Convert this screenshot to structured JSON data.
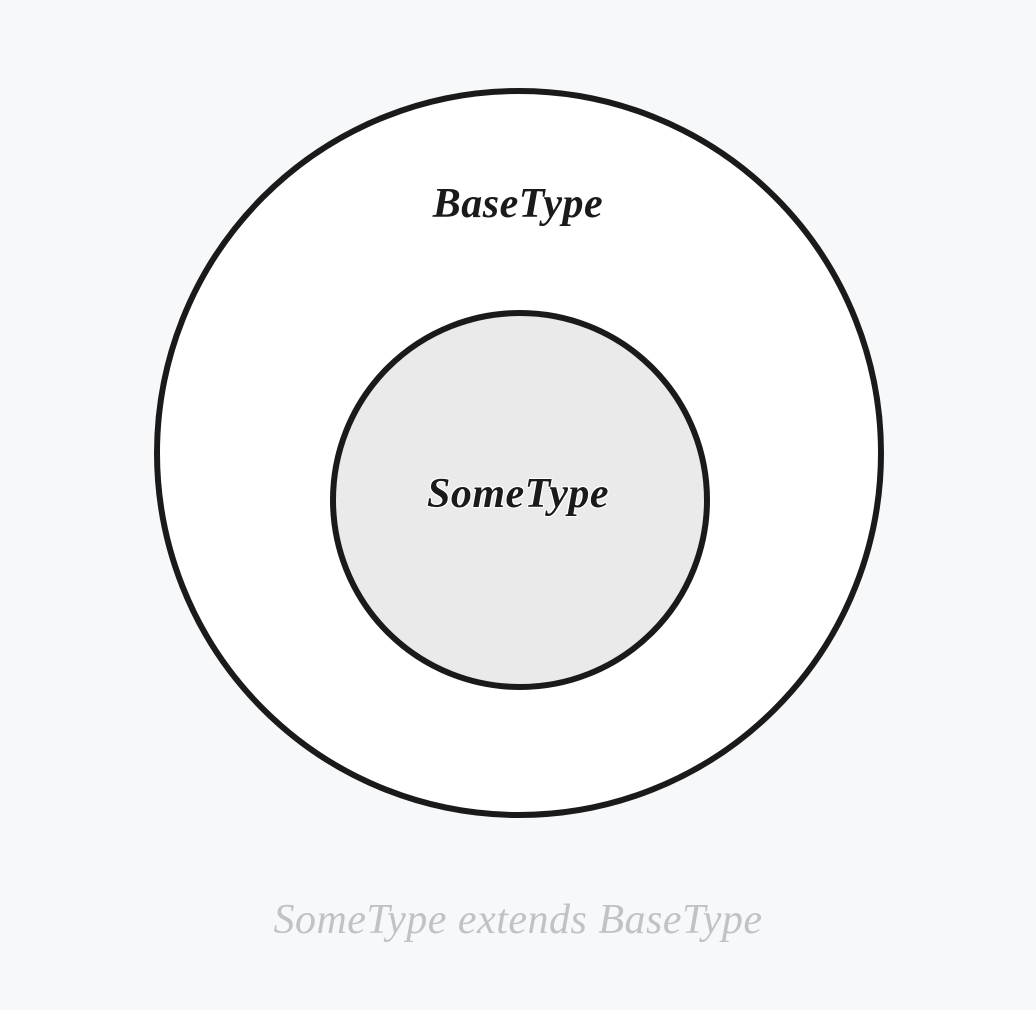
{
  "diagram": {
    "outer_label": "BaseType",
    "inner_label": "SomeType",
    "caption": "SomeType extends BaseType",
    "colors": {
      "background": "#f7f8f9",
      "stroke": "#1a1a1a",
      "outer_fill": "#ffffff",
      "inner_fill": "#eaeaea",
      "caption_text": "#bfc2c7"
    }
  }
}
